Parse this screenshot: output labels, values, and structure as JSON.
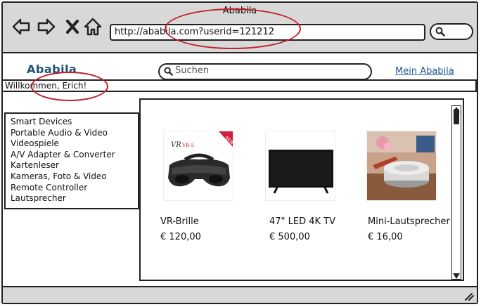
{
  "window": {
    "title": "Ababila"
  },
  "browser": {
    "url": "http://ababila.com?userid=121212",
    "nav_icons": [
      "back-arrow-icon",
      "forward-arrow-icon",
      "close-x-icon",
      "home-icon"
    ]
  },
  "header": {
    "brand": "Ababila",
    "search_placeholder": "Suchen",
    "account_link": "Mein Ababila"
  },
  "welcome": "Willkommen, Erich!",
  "categories": [
    "Smart Devices",
    "Portable Audio & Video",
    "Videospiele",
    "A/V Adapter & Converter",
    "Kartenleser",
    "Kameras, Foto & Video",
    "Remote Controller",
    "Lautsprecher"
  ],
  "products": [
    {
      "name": "VR-Brille",
      "price": "€ 120,00",
      "badge": "NEW",
      "brand_mark": "VR",
      "model": "VR-5"
    },
    {
      "name": "47\" LED 4K TV",
      "price": "€ 500,00"
    },
    {
      "name": "Mini-Lautsprecher",
      "price": "€ 16,00"
    }
  ],
  "colors": {
    "annotation": "#c0202a",
    "brand": "#1e4f7a",
    "link": "#1e5a96",
    "chrome": "#d8d8d8"
  }
}
